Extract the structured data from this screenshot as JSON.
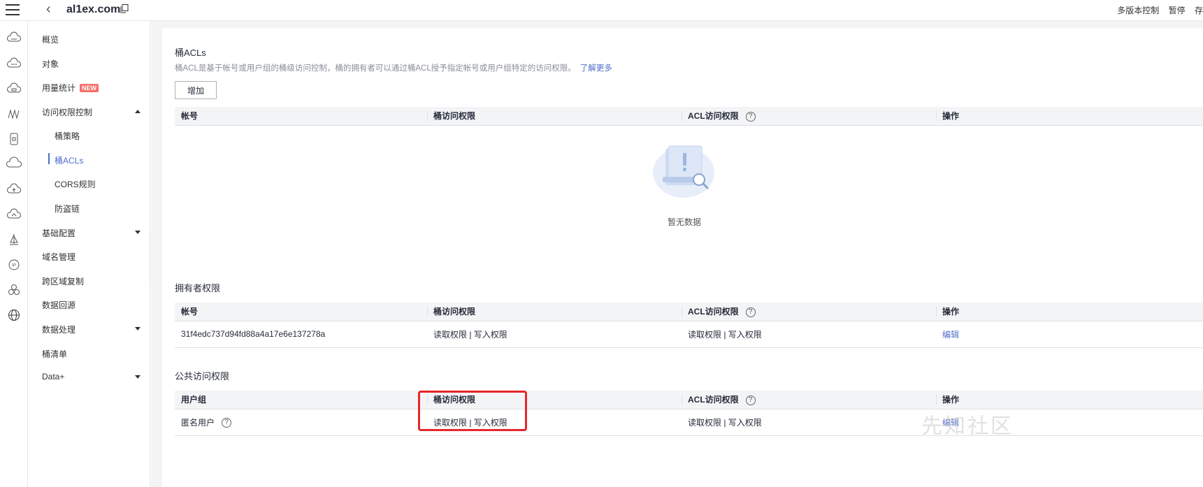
{
  "topbar": {
    "bucket_name": "al1ex.com",
    "right_items": [
      "多版本控制",
      "暂停",
      "存"
    ]
  },
  "rail_icons": [
    "cloud-server-icon",
    "cloud-more-icon",
    "cloud-storage-icon",
    "network-icon",
    "phone-icon",
    "cloud-icon",
    "cloud-upload-icon",
    "cloud-search-icon",
    "sailboat-icon",
    "ip-icon",
    "cluster-icon",
    "globe-icon"
  ],
  "sidebar": {
    "overview": "概览",
    "objects": "对象",
    "usage": "用量统计",
    "new_badge": "NEW",
    "access_control": "访问权限控制",
    "bucket_policy": "桶策略",
    "bucket_acls": "桶ACLs",
    "cors": "CORS规则",
    "hotlink": "防盗链",
    "basic_config": "基础配置",
    "domain": "域名管理",
    "cross_region": "跨区域复制",
    "back_to_source": "数据回源",
    "data_processing": "数据处理",
    "inventory": "桶清单",
    "data_plus": "Data+"
  },
  "acl_section": {
    "title": "桶ACLs",
    "description": "桶ACL是基于帐号或用户组的桶级访问控制，桶的拥有者可以通过桶ACL授予指定帐号或用户组特定的访问权限。",
    "learn_more": "了解更多",
    "add_button": "增加",
    "columns": [
      "帐号",
      "桶访问权限",
      "ACL访问权限",
      "操作"
    ],
    "empty_text": "暂无数据"
  },
  "owner_section": {
    "title": "拥有者权限",
    "columns": [
      "帐号",
      "桶访问权限",
      "ACL访问权限",
      "操作"
    ],
    "rows": [
      {
        "account": "31f4edc737d94fd88a4a17e6e137278a",
        "bucket_perm": "读取权限 | 写入权限",
        "acl_perm": "读取权限 | 写入权限",
        "action": "编辑"
      }
    ]
  },
  "public_section": {
    "title": "公共访问权限",
    "columns": [
      "用户组",
      "桶访问权限",
      "ACL访问权限",
      "操作"
    ],
    "rows": [
      {
        "group": "匿名用户",
        "bucket_perm": "读取权限 | 写入权限",
        "acl_perm": "读取权限 | 写入权限",
        "action": "编辑"
      }
    ]
  },
  "watermark": "先知社区",
  "colors": {
    "accent": "#526ecc",
    "highlight": "#e6262a",
    "badge": "#f66f6a"
  }
}
